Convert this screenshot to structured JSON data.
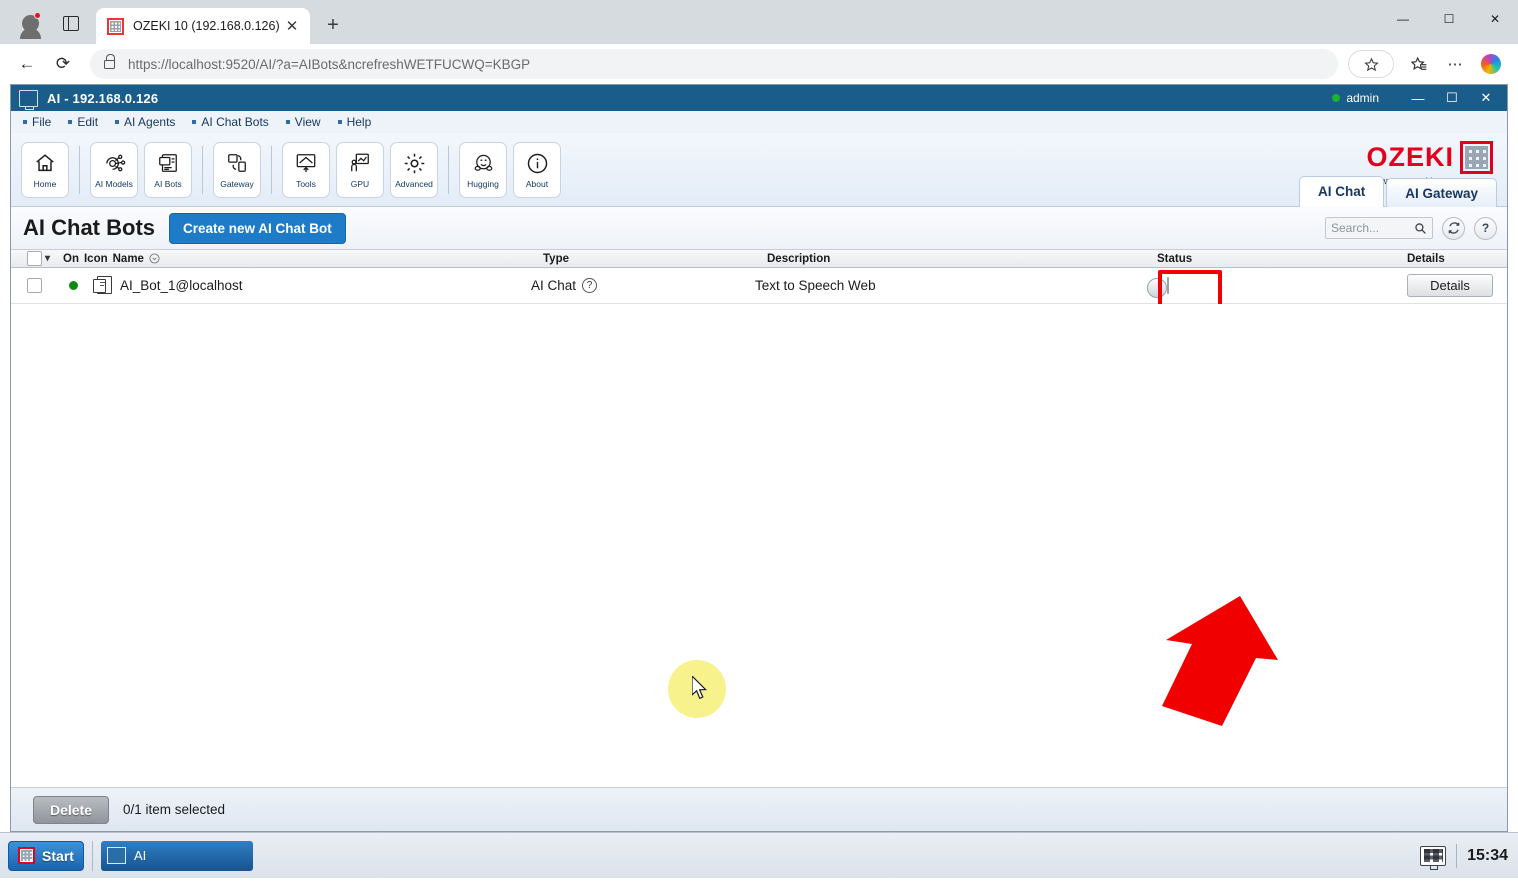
{
  "browser": {
    "tab": {
      "title": "OZEKI 10 (192.168.0.126)",
      "favicon": "ozeki-grid-icon",
      "close": "✕"
    },
    "new_tab": "+",
    "nav": {
      "back": "←",
      "reload": "⟳"
    },
    "omnibox": {
      "url": "https://localhost:9520/AI/?a=AIBots&ncrefreshWETFUCWQ=KBGP",
      "lock": "lock-icon"
    },
    "toolbar_right": {
      "favorite": "☆",
      "collections": "☆",
      "settings": "⋯",
      "copilot": "copilot-icon"
    },
    "window": {
      "minimize": "—",
      "maximize": "☐",
      "close": "✕"
    }
  },
  "app": {
    "titlebar": {
      "title": "AI - 192.168.0.126",
      "user": "admin",
      "minimize": "—",
      "maximize": "☐",
      "close": "✕"
    },
    "menu": [
      {
        "label": "File"
      },
      {
        "label": "Edit"
      },
      {
        "label": "AI Agents"
      },
      {
        "label": "AI Chat Bots"
      },
      {
        "label": "View"
      },
      {
        "label": "Help"
      }
    ],
    "toolbar_groups": [
      {
        "buttons": [
          {
            "label": "Home",
            "icon": "home-icon"
          }
        ]
      },
      {
        "buttons": [
          {
            "label": "AI Models",
            "icon": "ai-models-icon"
          },
          {
            "label": "AI Bots",
            "icon": "ai-bots-icon"
          }
        ]
      },
      {
        "buttons": [
          {
            "label": "Gateway",
            "icon": "gateway-icon"
          }
        ]
      },
      {
        "buttons": [
          {
            "label": "Tools",
            "icon": "tools-icon"
          },
          {
            "label": "GPU",
            "icon": "gpu-icon"
          },
          {
            "label": "Advanced",
            "icon": "advanced-gear-icon"
          }
        ]
      },
      {
        "buttons": [
          {
            "label": "Hugging",
            "icon": "hugging-face-icon"
          },
          {
            "label": "About",
            "icon": "info-icon"
          }
        ]
      }
    ],
    "brand": {
      "name": "OZEKI",
      "www": "www.",
      "my": "my",
      "rest": "ozeki.com"
    },
    "tabs": [
      {
        "label": "AI Chat",
        "active": true
      },
      {
        "label": "AI Gateway",
        "active": false
      }
    ]
  },
  "page": {
    "title": "AI Chat Bots",
    "create_button": "Create new AI Chat Bot",
    "search": {
      "placeholder": "Search...",
      "value": "",
      "icon": "search-icon"
    },
    "refresh_icon": "⟳",
    "help_icon": "?",
    "columns": {
      "select": "",
      "on": "On",
      "icon": "Icon",
      "name": "Name",
      "type": "Type",
      "description": "Description",
      "status": "Status",
      "details": "Details"
    },
    "rows": [
      {
        "selected": false,
        "on": "online",
        "name": "AI_Bot_1@localhost",
        "type": "AI Chat",
        "type_hint": "?",
        "description": "Text to Speech Web",
        "status_enabled": true,
        "details_label": "Details"
      }
    ],
    "footer": {
      "delete_label": "Delete",
      "selection": "0/1 item selected"
    }
  },
  "annotations": {
    "highlight_color": "#f10000",
    "arrow_color": "#f10000",
    "cursor_highlight_color": "#f7f28c"
  },
  "taskbar": {
    "start": "Start",
    "items": [
      {
        "label": "AI",
        "icon": "ozeki-ai-icon"
      }
    ],
    "tray": {
      "monitor_icon": "monitor-icon",
      "clock": "15:34"
    }
  }
}
